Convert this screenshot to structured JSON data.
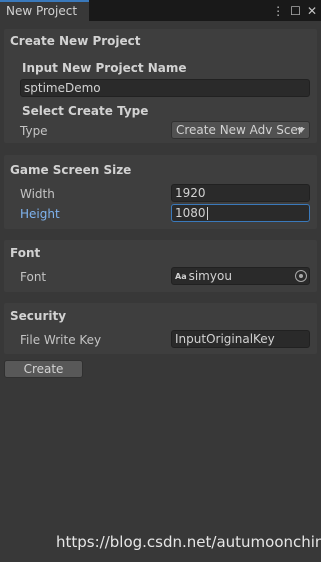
{
  "window": {
    "tab_title": "New Project",
    "menu_icon": "kebab-menu-icon",
    "maximize_icon": "maximize-icon",
    "close_icon": "close-icon"
  },
  "create_section": {
    "title": "Create New Project",
    "name_heading": "Input New Project Name",
    "name_value": "sptimeDemo",
    "type_heading": "Select Create Type",
    "type_label": "Type",
    "type_value": "Create New Adv Scer"
  },
  "screen_section": {
    "title": "Game Screen Size",
    "width_label": "Width",
    "width_value": "1920",
    "height_label": "Height",
    "height_value": "1080"
  },
  "font_section": {
    "title": "Font",
    "font_label": "Font",
    "font_value": "simyou",
    "font_type_icon": "Aa"
  },
  "security_section": {
    "title": "Security",
    "key_label": "File Write Key",
    "key_value": "InputOriginalKey"
  },
  "actions": {
    "create_label": "Create"
  },
  "watermark": "https://blog.csdn.net/autumoonchina",
  "colors": {
    "focus_accent": "#3a79bb",
    "active_label": "#7fb4f0",
    "background": "#383838"
  }
}
